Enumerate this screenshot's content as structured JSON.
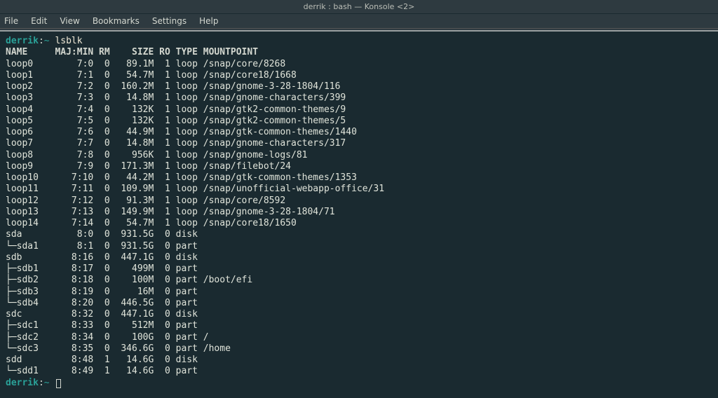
{
  "window": {
    "title": "derrik : bash — Konsole <2>"
  },
  "menus": [
    "File",
    "Edit",
    "View",
    "Bookmarks",
    "Settings",
    "Help"
  ],
  "prompt": {
    "host": "derrik",
    "sep": ":",
    "path": "~",
    "command": "lsblk"
  },
  "columns": [
    "NAME",
    "MAJ:MIN",
    "RM",
    "SIZE",
    "RO",
    "TYPE",
    "MOUNTPOINT"
  ],
  "rows": [
    {
      "name": "loop0",
      "maj": "7:0",
      "rm": "0",
      "size": "89.1M",
      "ro": "1",
      "type": "loop",
      "mnt": "/snap/core/8268",
      "indent": ""
    },
    {
      "name": "loop1",
      "maj": "7:1",
      "rm": "0",
      "size": "54.7M",
      "ro": "1",
      "type": "loop",
      "mnt": "/snap/core18/1668",
      "indent": ""
    },
    {
      "name": "loop2",
      "maj": "7:2",
      "rm": "0",
      "size": "160.2M",
      "ro": "1",
      "type": "loop",
      "mnt": "/snap/gnome-3-28-1804/116",
      "indent": ""
    },
    {
      "name": "loop3",
      "maj": "7:3",
      "rm": "0",
      "size": "14.8M",
      "ro": "1",
      "type": "loop",
      "mnt": "/snap/gnome-characters/399",
      "indent": ""
    },
    {
      "name": "loop4",
      "maj": "7:4",
      "rm": "0",
      "size": "132K",
      "ro": "1",
      "type": "loop",
      "mnt": "/snap/gtk2-common-themes/9",
      "indent": ""
    },
    {
      "name": "loop5",
      "maj": "7:5",
      "rm": "0",
      "size": "132K",
      "ro": "1",
      "type": "loop",
      "mnt": "/snap/gtk2-common-themes/5",
      "indent": ""
    },
    {
      "name": "loop6",
      "maj": "7:6",
      "rm": "0",
      "size": "44.9M",
      "ro": "1",
      "type": "loop",
      "mnt": "/snap/gtk-common-themes/1440",
      "indent": ""
    },
    {
      "name": "loop7",
      "maj": "7:7",
      "rm": "0",
      "size": "14.8M",
      "ro": "1",
      "type": "loop",
      "mnt": "/snap/gnome-characters/317",
      "indent": ""
    },
    {
      "name": "loop8",
      "maj": "7:8",
      "rm": "0",
      "size": "956K",
      "ro": "1",
      "type": "loop",
      "mnt": "/snap/gnome-logs/81",
      "indent": ""
    },
    {
      "name": "loop9",
      "maj": "7:9",
      "rm": "0",
      "size": "171.3M",
      "ro": "1",
      "type": "loop",
      "mnt": "/snap/filebot/24",
      "indent": ""
    },
    {
      "name": "loop10",
      "maj": "7:10",
      "rm": "0",
      "size": "44.2M",
      "ro": "1",
      "type": "loop",
      "mnt": "/snap/gtk-common-themes/1353",
      "indent": ""
    },
    {
      "name": "loop11",
      "maj": "7:11",
      "rm": "0",
      "size": "109.9M",
      "ro": "1",
      "type": "loop",
      "mnt": "/snap/unofficial-webapp-office/31",
      "indent": ""
    },
    {
      "name": "loop12",
      "maj": "7:12",
      "rm": "0",
      "size": "91.3M",
      "ro": "1",
      "type": "loop",
      "mnt": "/snap/core/8592",
      "indent": ""
    },
    {
      "name": "loop13",
      "maj": "7:13",
      "rm": "0",
      "size": "149.9M",
      "ro": "1",
      "type": "loop",
      "mnt": "/snap/gnome-3-28-1804/71",
      "indent": ""
    },
    {
      "name": "loop14",
      "maj": "7:14",
      "rm": "0",
      "size": "54.7M",
      "ro": "1",
      "type": "loop",
      "mnt": "/snap/core18/1650",
      "indent": ""
    },
    {
      "name": "sda",
      "maj": "8:0",
      "rm": "0",
      "size": "931.5G",
      "ro": "0",
      "type": "disk",
      "mnt": "",
      "indent": ""
    },
    {
      "name": "sda1",
      "maj": "8:1",
      "rm": "0",
      "size": "931.5G",
      "ro": "0",
      "type": "part",
      "mnt": "",
      "indent": "└─"
    },
    {
      "name": "sdb",
      "maj": "8:16",
      "rm": "0",
      "size": "447.1G",
      "ro": "0",
      "type": "disk",
      "mnt": "",
      "indent": ""
    },
    {
      "name": "sdb1",
      "maj": "8:17",
      "rm": "0",
      "size": "499M",
      "ro": "0",
      "type": "part",
      "mnt": "",
      "indent": "├─"
    },
    {
      "name": "sdb2",
      "maj": "8:18",
      "rm": "0",
      "size": "100M",
      "ro": "0",
      "type": "part",
      "mnt": "/boot/efi",
      "indent": "├─"
    },
    {
      "name": "sdb3",
      "maj": "8:19",
      "rm": "0",
      "size": "16M",
      "ro": "0",
      "type": "part",
      "mnt": "",
      "indent": "├─"
    },
    {
      "name": "sdb4",
      "maj": "8:20",
      "rm": "0",
      "size": "446.5G",
      "ro": "0",
      "type": "part",
      "mnt": "",
      "indent": "└─"
    },
    {
      "name": "sdc",
      "maj": "8:32",
      "rm": "0",
      "size": "447.1G",
      "ro": "0",
      "type": "disk",
      "mnt": "",
      "indent": ""
    },
    {
      "name": "sdc1",
      "maj": "8:33",
      "rm": "0",
      "size": "512M",
      "ro": "0",
      "type": "part",
      "mnt": "",
      "indent": "├─"
    },
    {
      "name": "sdc2",
      "maj": "8:34",
      "rm": "0",
      "size": "100G",
      "ro": "0",
      "type": "part",
      "mnt": "/",
      "indent": "├─"
    },
    {
      "name": "sdc3",
      "maj": "8:35",
      "rm": "0",
      "size": "346.6G",
      "ro": "0",
      "type": "part",
      "mnt": "/home",
      "indent": "└─"
    },
    {
      "name": "sdd",
      "maj": "8:48",
      "rm": "1",
      "size": "14.6G",
      "ro": "0",
      "type": "disk",
      "mnt": "",
      "indent": ""
    },
    {
      "name": "sdd1",
      "maj": "8:49",
      "rm": "1",
      "size": "14.6G",
      "ro": "0",
      "type": "part",
      "mnt": "",
      "indent": "└─"
    }
  ]
}
